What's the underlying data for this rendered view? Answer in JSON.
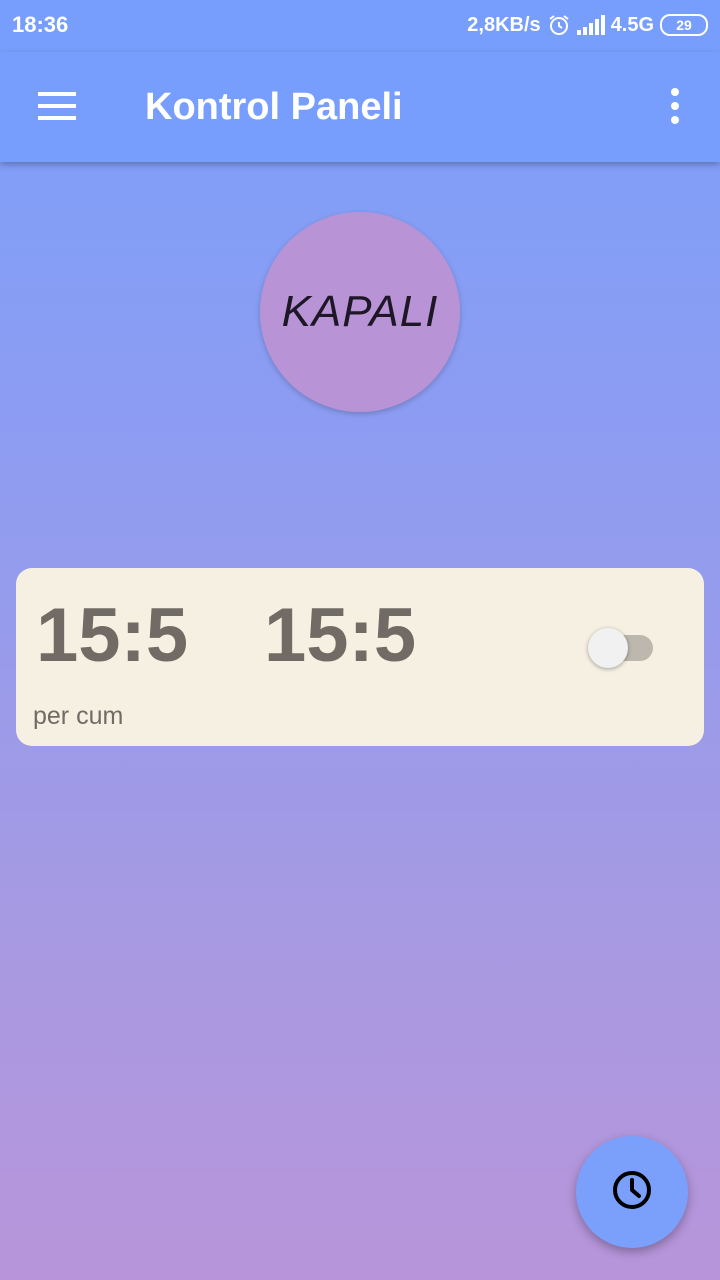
{
  "status_bar": {
    "time": "18:36",
    "network_speed": "2,8KB/s",
    "network_type": "4.5G",
    "battery": "29",
    "icons": [
      "alarm-icon",
      "signal-icon",
      "battery-icon"
    ]
  },
  "app_bar": {
    "title": "Kontrol Paneli",
    "menu_icon": "hamburger-menu-icon",
    "overflow_icon": "more-vert-icon"
  },
  "state_button": {
    "label": "KAPALI"
  },
  "schedule": {
    "start_time": "15:5",
    "end_time": "15:5",
    "days": "per cum",
    "enabled": false
  },
  "fab": {
    "icon": "clock-icon"
  },
  "colors": {
    "app_bar": "#779efc",
    "state_circle": "#b893d6",
    "card_background": "#f6f0e2",
    "card_text": "#706c65",
    "fab": "#7aa0fb"
  }
}
